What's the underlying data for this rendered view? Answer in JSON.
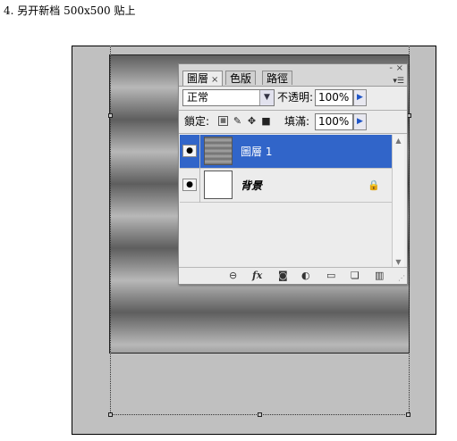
{
  "caption": "4. 另开新档 500x500 贴上",
  "panel": {
    "tabs": [
      {
        "label": "圖層",
        "close": "×"
      },
      {
        "label": "色版"
      },
      {
        "label": "路徑"
      }
    ],
    "window_controls": {
      "minimize": "-",
      "close": "×"
    },
    "menu_icon": "menu-arrow-icon",
    "blend_mode": "正常",
    "opacity_label": "不透明:",
    "opacity_value": "100%",
    "lock_label": "鎖定:",
    "fill_label": "填滿:",
    "fill_value": "100%",
    "layers": [
      {
        "name": "圖層 1",
        "selected": true,
        "visible": true
      },
      {
        "name": "背景",
        "selected": false,
        "visible": true,
        "locked": true
      }
    ],
    "bottom_icons": [
      "link-icon",
      "fx-icon",
      "mask-icon",
      "adjustment-icon",
      "folder-icon",
      "new-layer-icon",
      "trash-icon"
    ],
    "fx_label": "fx",
    "selection_color": "#3165c9"
  }
}
